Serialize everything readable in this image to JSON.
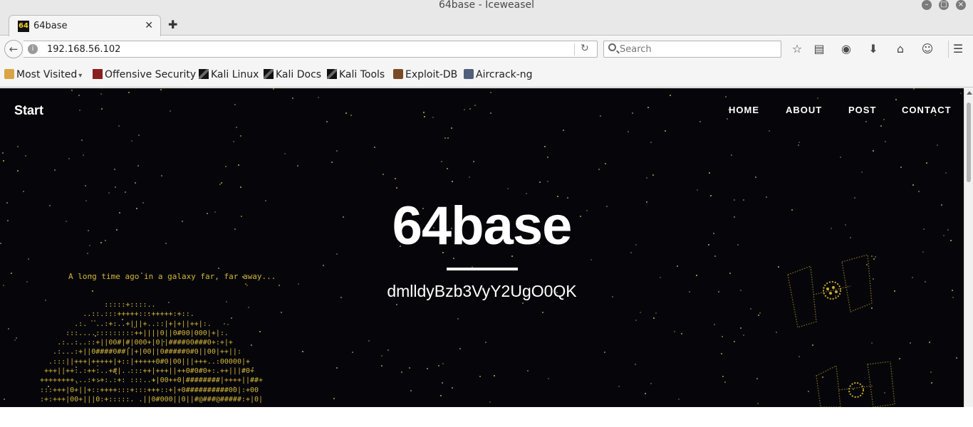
{
  "window": {
    "title": "64base - Iceweasel"
  },
  "tabs": [
    {
      "favicon_text": "64",
      "label": "64base"
    }
  ],
  "navbar": {
    "url": "192.168.56.102",
    "search_placeholder": "Search"
  },
  "bookmarks": [
    {
      "label": "Most Visited",
      "icon": "folder-icon"
    },
    {
      "label": "Offensive Security",
      "icon": "offsec-icon"
    },
    {
      "label": "Kali Linux",
      "icon": "dragon-icon"
    },
    {
      "label": "Kali Docs",
      "icon": "dragon-icon"
    },
    {
      "label": "Kali Tools",
      "icon": "dragon-icon"
    },
    {
      "label": "Exploit-DB",
      "icon": "spider-icon"
    },
    {
      "label": "Aircrack-ng",
      "icon": "aircrack-icon"
    }
  ],
  "site": {
    "brand": "Start",
    "nav": [
      "HOME",
      "ABOUT",
      "POST",
      "CONTACT"
    ],
    "hero_title": "64base",
    "hero_subtitle": "dmlldyBzb3VyY2UgO0QK",
    "crawl_text": "A long time ago in a galaxy far, far away...",
    "ascii_art": "               :::::+::::..\n          ..::.:::+++++:::+++++:+::.\n        .:.  ..:+:..+|||+..::|+|+||++|:.\n      :::....:::::::::++||||0||0#00|000|+|:.\n    .:..:..::+||00#|#|000+|0||####00###0+:+|+\n   .:...:+||0####0##||+|00||0#####0#0||00|++||:\n  .:::||+++|+++++|+::|+++++0#0|00|||+++..:00000|+\n +++||++:.:++:..+#|. :::++|+++||++0#0#0+:.++|||#0+\n++++++++...:+:+:.:+: :::..+|00++0|########|++++||##+\n:::+++|0+||+::++++:::+:::+++::+|+0##########00|:+00\n:+:+++|00+|||0:+:::::. .||0#000||0||#@###@#####:+|0|"
  },
  "colors": {
    "page_background": "#06060a",
    "star": "#c9b45a",
    "ascii": "#d4b53a"
  }
}
